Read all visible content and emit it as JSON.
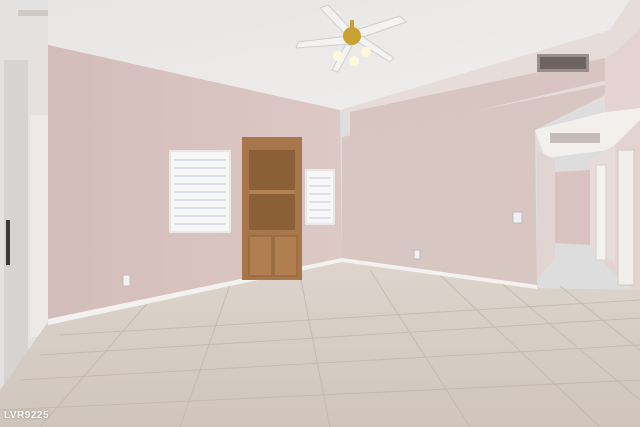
{
  "photo": {
    "watermark": "LVR9225",
    "colors": {
      "ceiling": "#ecebea",
      "wall_left": "#d9c4c1",
      "wall_back": "#d4c2c0",
      "wall_right": "#e2d1cf",
      "floor": "#d2c9c1",
      "grout": "#bcb2a9",
      "wood": "#a7764a",
      "baseboard": "#f4f2f0",
      "window_light": "#f6f8fb",
      "fan_brass": "#c9a233"
    }
  }
}
